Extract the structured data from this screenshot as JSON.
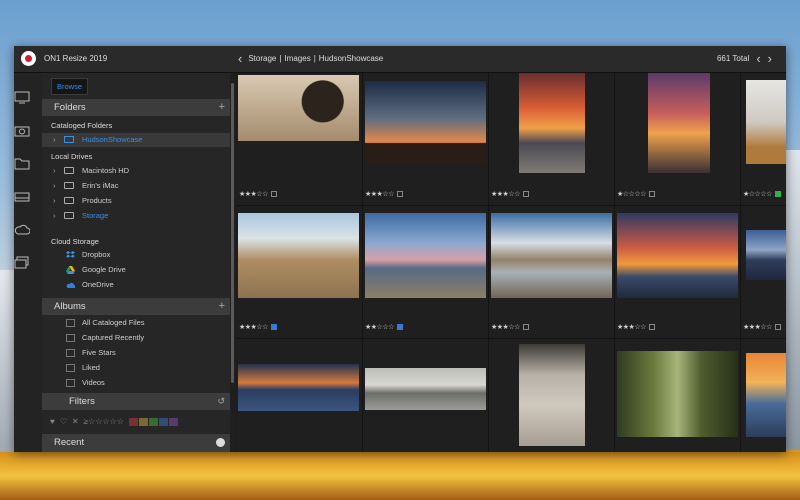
{
  "app": {
    "title": "ON1 Resize 2019"
  },
  "breadcrumb": {
    "parts": [
      "Storage",
      "|",
      "Images",
      "|",
      "HudsonShowcase"
    ]
  },
  "count": {
    "label": "661 Total"
  },
  "browse": {
    "label": "Browse"
  },
  "folders": {
    "header": "Folders",
    "cataloged_label": "Cataloged Folders",
    "cataloged_item": "HudsonShowcase",
    "local_label": "Local Drives",
    "drives": [
      "Macintosh HD",
      "Erin's iMac",
      "Products",
      "Storage"
    ]
  },
  "cloud": {
    "label": "Cloud Storage",
    "items": [
      "Dropbox",
      "Google Drive",
      "OneDrive"
    ]
  },
  "albums": {
    "header": "Albums",
    "items": [
      "All Cataloged Files",
      "Captured Recently",
      "Five Stars",
      "Liked",
      "Videos"
    ]
  },
  "filters": {
    "header": "Filters"
  },
  "recent": {
    "header": "Recent"
  },
  "grid": {
    "ratings": [
      [
        "★★★☆☆",
        "★★★☆☆",
        "★★★☆☆",
        "★☆☆☆☆",
        "★☆☆☆☆"
      ],
      [
        "★★★☆☆",
        "★★☆☆☆",
        "★★★☆☆",
        "★★★☆☆",
        "★★★☆☆"
      ]
    ]
  },
  "colors": {
    "accent": "#3a8fe0",
    "label_green": "#2fb14b",
    "label_blue": "#3a78d8"
  }
}
